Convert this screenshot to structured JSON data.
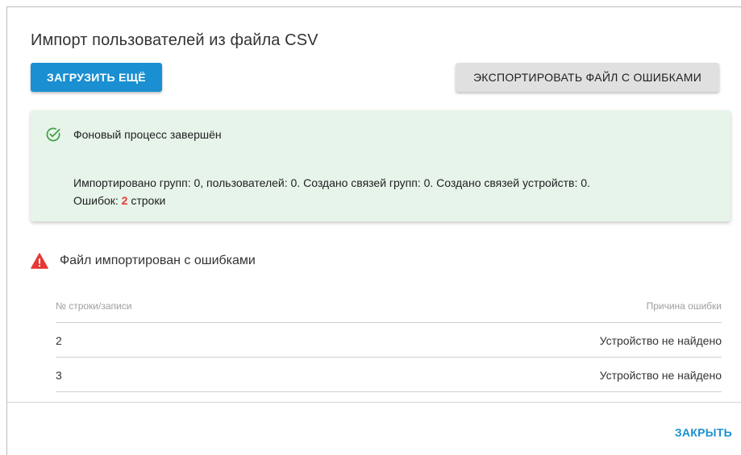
{
  "dialog": {
    "title": "Импорт пользователей из файла CSV",
    "upload_more_label": "ЗАГРУЗИТЬ ЕЩЁ",
    "export_errors_label": "ЭКСПОРТИРОВАТЬ ФАЙЛ С ОШИБКАМИ",
    "close_label": "ЗАКРЫТЬ"
  },
  "success_alert": {
    "icon": "check-circle-icon",
    "title": "Фоновый процесс завершён",
    "summary": "Импортировано групп: 0, пользователей: 0. Создано связей групп: 0. Создано связей устройств: 0.",
    "errors_prefix": "Ошибок:",
    "errors_count": "2",
    "errors_suffix": "строки",
    "color": "#e6f4ea"
  },
  "warning": {
    "icon": "warning-triangle-icon",
    "title": "Файл импортирован с ошибками",
    "color": "#e53935"
  },
  "errors_table": {
    "columns": [
      "№ строки/записи",
      "Причина ошибки"
    ],
    "rows": [
      {
        "row": "2",
        "reason": "Устройство не найдено"
      },
      {
        "row": "3",
        "reason": "Устройство не найдено"
      }
    ]
  },
  "colors": {
    "accent": "#1a8fd1",
    "success_icon": "#43a047"
  }
}
